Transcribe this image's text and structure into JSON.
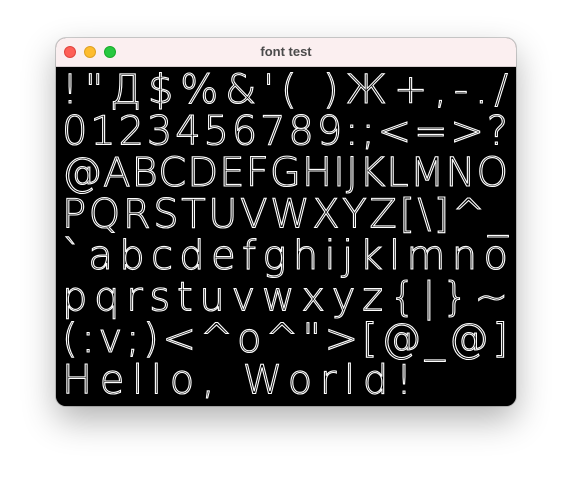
{
  "window": {
    "title": "font test",
    "buttons": {
      "close": "close",
      "minimize": "minimize",
      "maximize": "maximize"
    }
  },
  "canvas": {
    "background": "#000000",
    "text_color": "#ffffff",
    "lines": [
      " !\"Д$%&'( )Ж+,-./",
      "0123456789:;<=>?",
      "@ABCDEFGHIJKLMNO",
      "PQRSTUVWXYZ[\\]^_",
      "`abcdefghijklmno",
      "pqrstuvwxyz{|}~",
      "(:v;)<^o^\">[@_@]",
      "Hello, World!"
    ]
  }
}
